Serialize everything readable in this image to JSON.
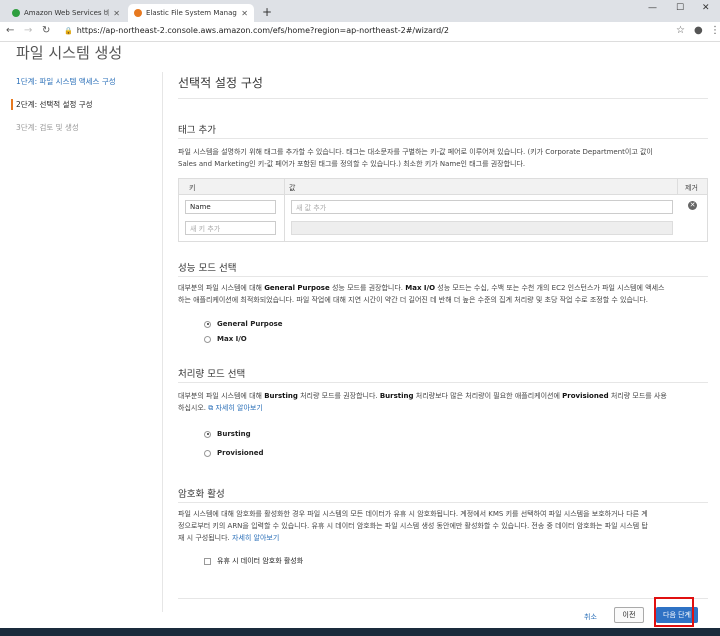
{
  "browser": {
    "tabs": [
      {
        "title": "Amazon Web Services 비밀번호",
        "favicon_color": "#2e9e3e"
      },
      {
        "title": "Elastic File System Managem",
        "favicon_color": "#e7791f"
      }
    ],
    "url": "https://ap-northeast-2.console.aws.amazon.com/efs/home?region=ap-northeast-2#/wizard/2"
  },
  "page": {
    "title": "파일 시스템 생성"
  },
  "steps": [
    {
      "label": "1단계: 파일 시스템 액세스 구성"
    },
    {
      "label": "2단계: 선택적 설정 구성"
    },
    {
      "label": "3단계: 검토 및 생성"
    }
  ],
  "main": {
    "title": "선택적 설정 구성",
    "tags": {
      "heading": "태그 추가",
      "desc_line1": "파일 시스템을 설명하기 위해 태그를 추가할 수 있습니다. 태그는 대소문자를 구별하는 키-값 페어로 이루어져 있습니다. (키가 Corporate Department이고 값이",
      "desc_line2": "Sales and Marketing인 키-값 페어가 포함된 태그를 정의할 수 있습니다.) 최소한 키가 Name인 태그를 권장합니다.",
      "col_key": "키",
      "col_value": "값",
      "col_remove": "제거",
      "rows": [
        {
          "key": "Name",
          "value_placeholder": "새 값 추가"
        },
        {
          "key_placeholder": "새 키 추가"
        }
      ]
    },
    "performance": {
      "heading": "성능 모드 선택",
      "desc_pre": "대부분의 파일 시스템에 대해 ",
      "desc_b1": "General Purpose",
      "desc_mid": " 성능 모드를 권장합니다. ",
      "desc_b2": "Max I/O",
      "desc_rest1": " 성능 모드는 수십, 수백 또는 수천 개의 EC2 인스턴스가 파일 시스템에 액세스",
      "desc_line2": "하는 애플리케이션에 최적화되었습니다. 파일 작업에 대해 지연 시간이 약간 더 길어진 데 반해 더 높은 수준의 집계 처리량 및 초당 작업 수로 조정할 수 있습니다.",
      "options": [
        "General Purpose",
        "Max I/O"
      ],
      "selected": "General Purpose"
    },
    "throughput": {
      "heading": "처리량 모드 선택",
      "desc_pre": "대부분의 파일 시스템에 대해 ",
      "desc_b1": "Bursting",
      "desc_mid": " 처리량 모드를 권장합니다. ",
      "desc_b2": "Bursting",
      "desc_mid2": " 처리량보다 많은 처리량이 필요한 애플리케이션에 ",
      "desc_b3": "Provisioned",
      "desc_rest": " 처리량 모드를 사용",
      "desc_line2": "하십시오.",
      "learn_more": "자세히 알아보기",
      "options": [
        "Bursting",
        "Provisioned"
      ],
      "selected": "Bursting"
    },
    "encryption": {
      "heading": "암호화 활성",
      "desc_line1": "파일 시스템에 대해 암호화를 활성화한 경우 파일 시스템의 모든 데이터가 유휴 시 암호화됩니다. 계정에서 KMS 키를 선택하여 파일 시스템을 보호하거나 다른 계",
      "desc_line2": "정으로부터 키의 ARN을 입력할 수 있습니다. 유휴 시 데이터 암호화는 파일 시스템 생성 동안에만 활성화할 수 있습니다. 전송 중 데이터 암호화는 파일 시스템 탑",
      "desc_line3": "재 시 구성됩니다.",
      "learn_more": "자세히 알아보기",
      "checkbox_label": "유휴 시 데이터 암호화 활성화"
    }
  },
  "footer": {
    "cancel": "취소",
    "previous": "이전",
    "next": "다음 단계"
  }
}
